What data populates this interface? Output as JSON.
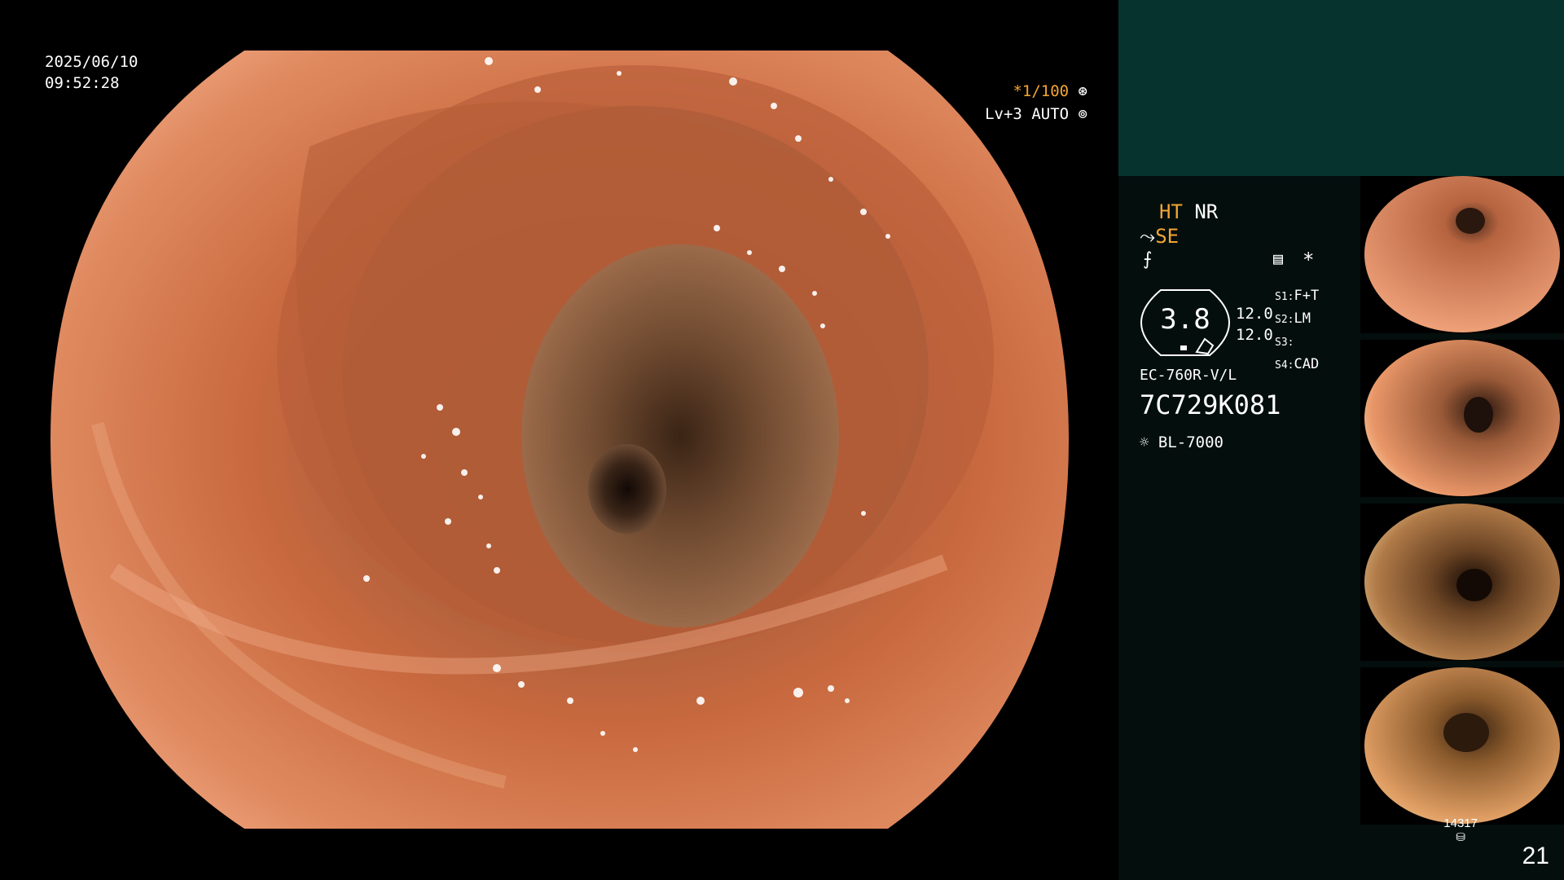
{
  "main_view": {
    "date": "2025/06/10",
    "time": "09:52:28",
    "shutter": "*1/100",
    "level_label": "Lv+3",
    "mode": "AUTO"
  },
  "sidebar": {
    "ht": "HT",
    "nr": "NR",
    "se": "SE",
    "gauge_value": "3.8",
    "values": [
      "12.0",
      "12.0"
    ],
    "settings": [
      {
        "key": "S1:",
        "val": "F+T"
      },
      {
        "key": "S2:",
        "val": "LM"
      },
      {
        "key": "S3:",
        "val": ""
      },
      {
        "key": "S4:",
        "val": "CAD"
      }
    ],
    "scope_model": "EC-760R-V/L",
    "serial": "7C729K081",
    "light_source": "BL-7000",
    "storage_count": "14317",
    "image_count": "21"
  },
  "colors": {
    "accent": "#f3a534",
    "sidebar_bg": "#030e0d",
    "sidebar_top": "#07332f"
  }
}
